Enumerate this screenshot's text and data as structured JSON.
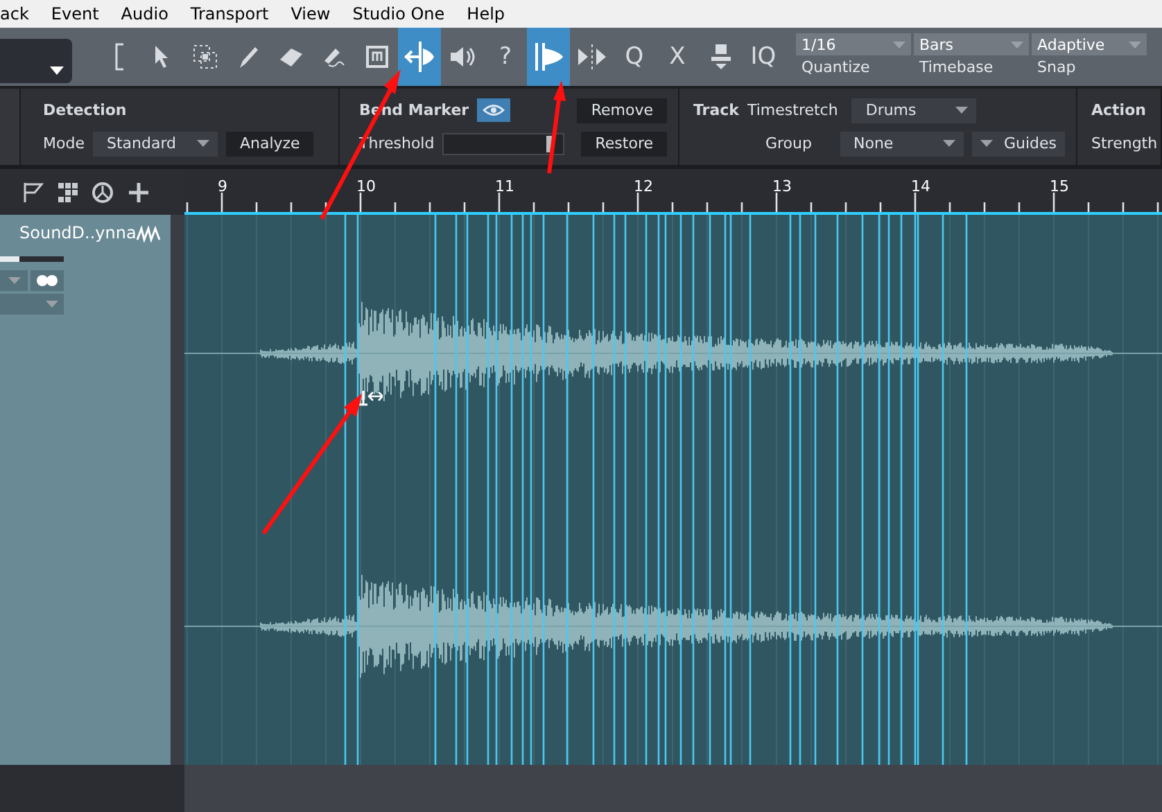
{
  "menu": [
    "ack",
    "Event",
    "Audio",
    "Transport",
    "View",
    "Studio One",
    "Help"
  ],
  "tools": [
    {
      "kind": "bracket",
      "selected": false
    },
    {
      "kind": "arrow",
      "selected": false
    },
    {
      "kind": "range",
      "selected": false
    },
    {
      "kind": "pencil",
      "selected": false
    },
    {
      "kind": "eraser",
      "selected": false
    },
    {
      "kind": "paint",
      "selected": false
    },
    {
      "kind": "mute",
      "selected": false
    },
    {
      "kind": "bend",
      "selected": true
    },
    {
      "kind": "speaker",
      "selected": false
    },
    {
      "kind": "text",
      "label": "?",
      "selected": false
    },
    {
      "kind": "bendview",
      "selected": true
    },
    {
      "kind": "split",
      "selected": false
    },
    {
      "kind": "text",
      "label": "Q",
      "selected": false
    },
    {
      "kind": "text",
      "label": "X",
      "selected": false
    },
    {
      "kind": "person",
      "selected": false
    },
    {
      "kind": "text",
      "label": "IQ",
      "selected": false
    }
  ],
  "snap_fields": [
    {
      "value": "1/16",
      "label": "Quantize"
    },
    {
      "value": "Bars",
      "label": "Timebase"
    },
    {
      "value": "Adaptive",
      "label": "Snap"
    }
  ],
  "detection": {
    "title": "Detection",
    "mode_label": "Mode",
    "mode": "Standard",
    "analyze": "Analyze"
  },
  "bend_marker": {
    "title": "Bend Marker",
    "visible": true,
    "threshold_label": "Threshold",
    "threshold": {
      "level": 0.88
    },
    "remove": "Remove",
    "restore": "Restore"
  },
  "track_section": {
    "title": "Track",
    "timestretch_label": "Timestretch",
    "timestretch": "Drums",
    "group_label": "Group",
    "group": "None",
    "guides": "Guides"
  },
  "action": {
    "title": "Action",
    "strength_label": "Strength"
  },
  "ruler": [
    "9",
    "10",
    "11",
    "12",
    "13",
    "14",
    "15"
  ],
  "track": {
    "name": "SoundD..ynna",
    "meter": {
      "level": 0.3
    },
    "monitor_on": true
  }
}
